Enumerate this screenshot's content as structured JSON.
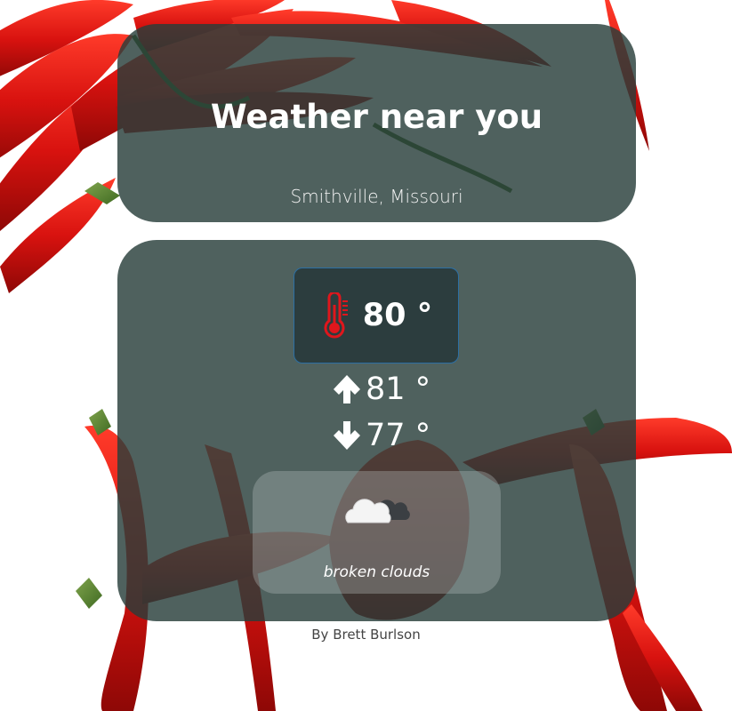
{
  "header": {
    "title": "Weather near you",
    "location": "Smithville, Missouri"
  },
  "weather": {
    "current_temp": "80 °",
    "high_temp": "81 °",
    "low_temp": "77 °",
    "condition": "broken clouds",
    "icons": {
      "temperature": "thermometer-icon",
      "high": "arrow-up-icon",
      "low": "arrow-down-icon",
      "condition": "broken-clouds-icon"
    }
  },
  "footer": {
    "credit": "By Brett Burlson"
  },
  "colors": {
    "card_bg": "#283e3a",
    "temp_box_bg": "#2c3d3e",
    "temp_box_border": "#2c6fa3",
    "thermometer": "#e0161c",
    "text": "#ffffff",
    "footer_text": "#444444"
  },
  "background": {
    "image": "red-chili-peppers"
  }
}
